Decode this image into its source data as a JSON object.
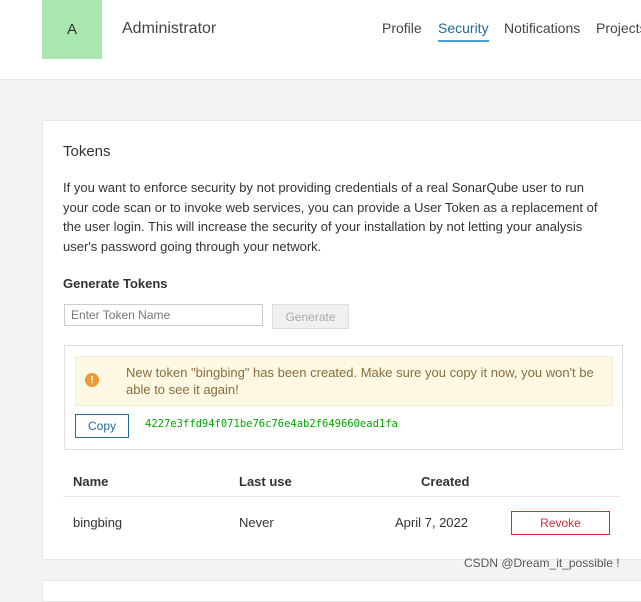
{
  "header": {
    "avatar_letter": "A",
    "user_name": "Administrator",
    "tabs": [
      {
        "label": "Profile"
      },
      {
        "label": "Security"
      },
      {
        "label": "Notifications"
      },
      {
        "label": "Projects"
      }
    ],
    "active_tab": "Security"
  },
  "tokens": {
    "title": "Tokens",
    "description": "If you want to enforce security by not providing credentials of a real SonarQube user to run your code scan or to invoke web services, you can provide a User Token as a replacement of the user login. This will increase the security of your installation by not letting your analysis user's password going through your network.",
    "generate_title": "Generate Tokens",
    "input_placeholder": "Enter Token Name",
    "generate_label": "Generate",
    "alert_text": "New token \"bingbing\" has been created. Make sure you copy it now, you won't be able to see it again!",
    "copy_label": "Copy",
    "token_value": "4227e3ffd94f071be76c76e4ab2f649660ead1fa",
    "table": {
      "headers": [
        "Name",
        "Last use",
        "Created"
      ],
      "rows": [
        {
          "name": "bingbing",
          "last_use": "Never",
          "created": "April 7, 2022",
          "action": "Revoke"
        }
      ]
    }
  },
  "watermark": "CSDN @Dream_it_possible !",
  "colors": {
    "avatar_bg": "#a8e8b0",
    "active_tab": "#236a97",
    "token_green": "#00aa00",
    "revoke_red": "#d02f3a",
    "alert_bg": "#fcf8e3"
  }
}
